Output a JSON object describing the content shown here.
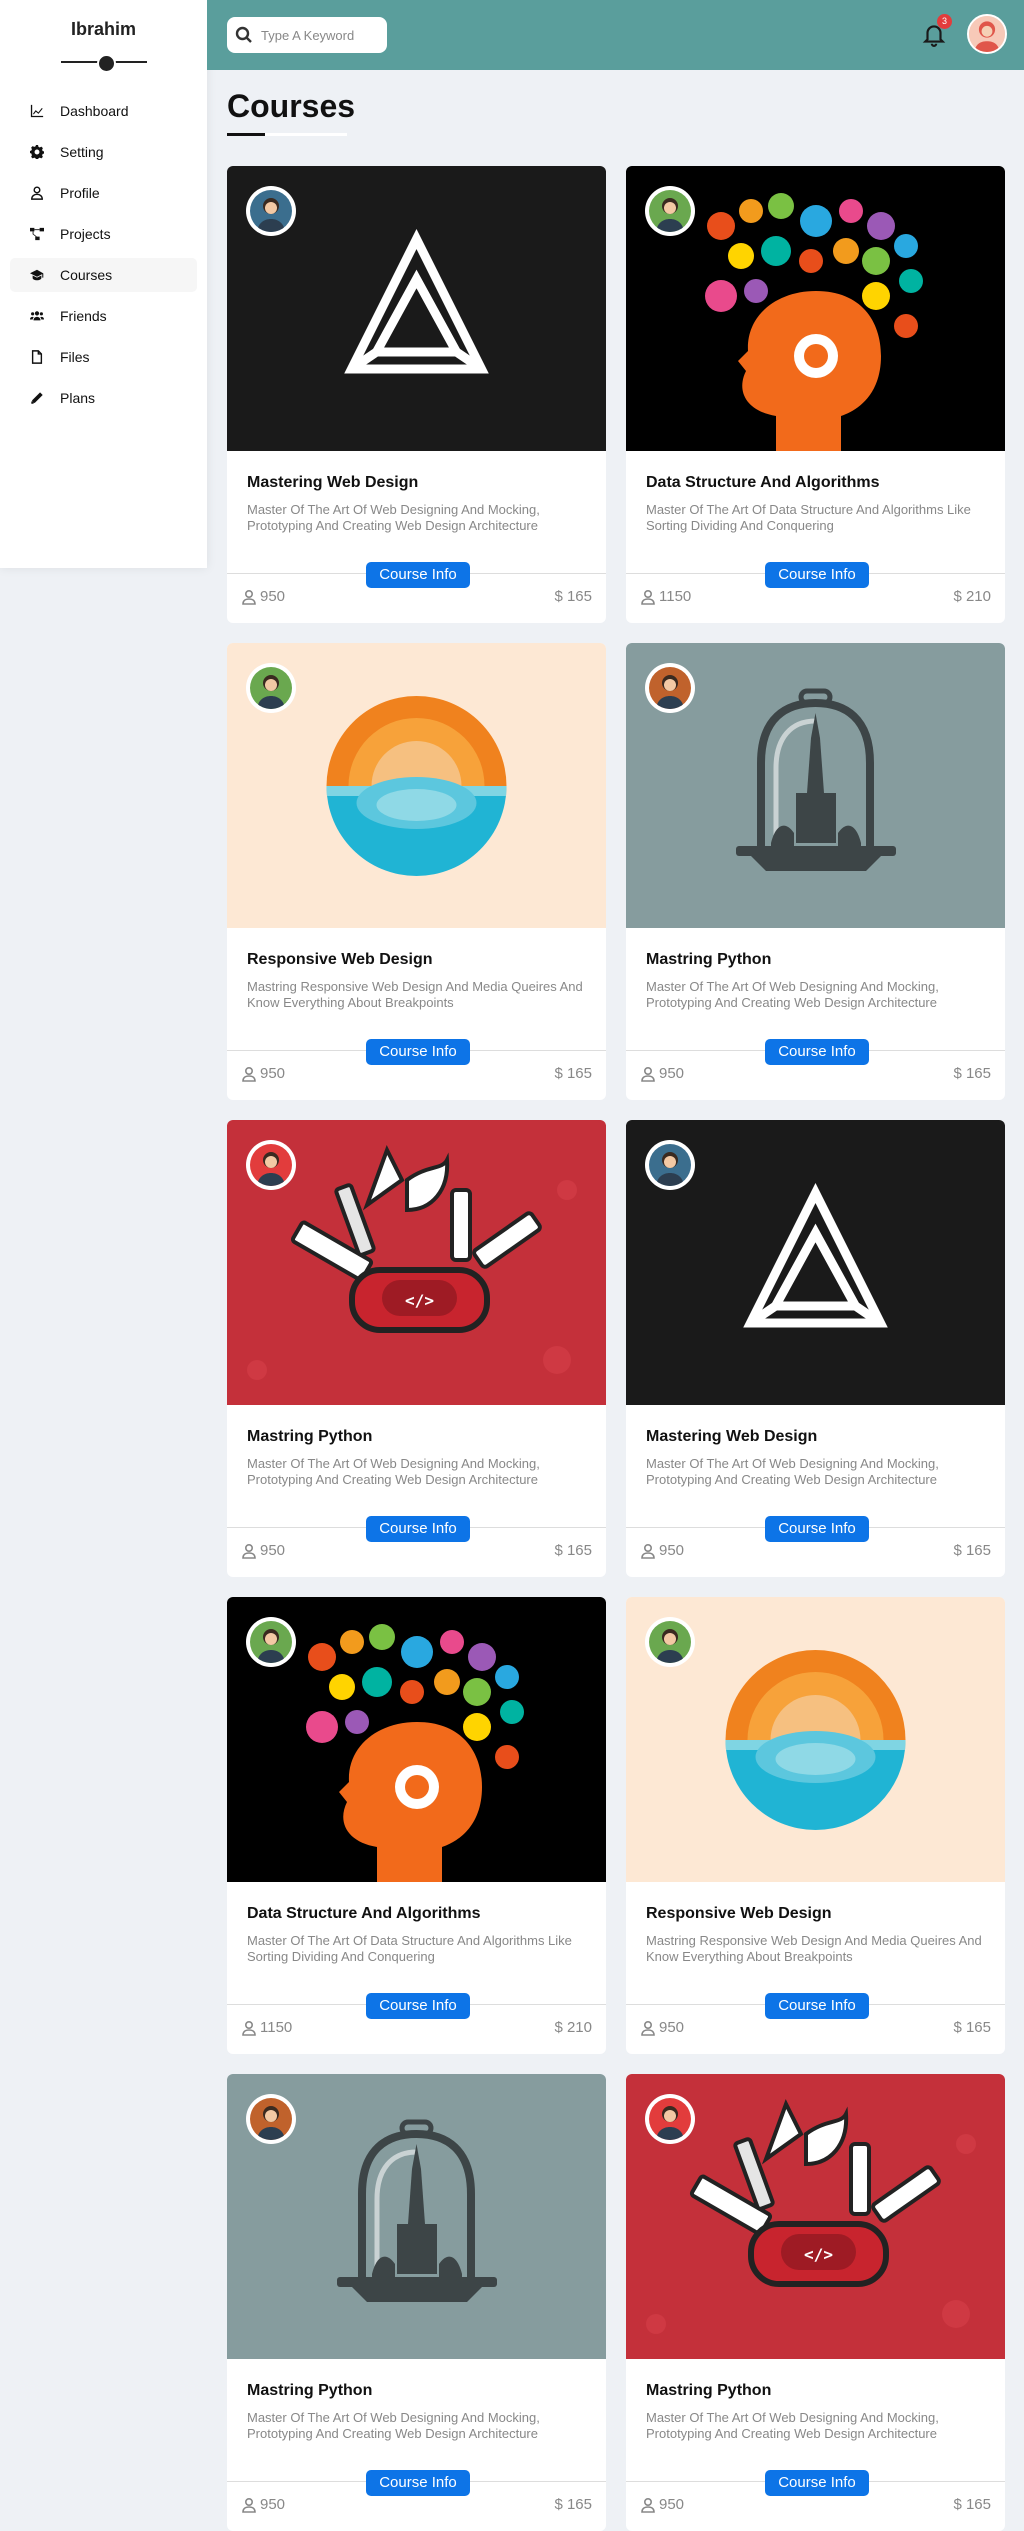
{
  "sidebar": {
    "brand": "Ibrahim",
    "items": [
      {
        "label": "Dashboard",
        "icon": "chart-line-icon"
      },
      {
        "label": "Setting",
        "icon": "gear-icon"
      },
      {
        "label": "Profile",
        "icon": "user-icon"
      },
      {
        "label": "Projects",
        "icon": "diagram-icon"
      },
      {
        "label": "Courses",
        "icon": "graduation-cap-icon"
      },
      {
        "label": "Friends",
        "icon": "users-icon"
      },
      {
        "label": "Files",
        "icon": "file-icon"
      },
      {
        "label": "Plans",
        "icon": "pen-icon"
      }
    ],
    "active_index": 4
  },
  "header": {
    "search_placeholder": "Type A Keyword",
    "notification_count": "3"
  },
  "page": {
    "title": "Courses"
  },
  "colors": {
    "header_bg": "#5a9e9c",
    "button": "#0d74e7",
    "badge": "#e33c3c"
  },
  "courses": [
    {
      "title": "Mastering Web Design",
      "desc": "Master Of The Art Of Web Designing And Mocking, Prototyping And Creating Web Design Architecture",
      "students": "950",
      "price": "$ 165",
      "button": "Course Info",
      "art": "triangle-logo",
      "bg": "#1a1a1a"
    },
    {
      "title": "Data Structure And Algorithms",
      "desc": "Master Of The Art Of Data Structure And Algorithms Like Sorting Dividing And Conquering",
      "students": "1150",
      "price": "$ 210",
      "button": "Course Info",
      "art": "head-ideas",
      "bg": "#000000"
    },
    {
      "title": "Responsive Web Design",
      "desc": "Mastring Responsive Web Design And Media Queires And Know Everything About Breakpoints",
      "students": "950",
      "price": "$ 165",
      "button": "Course Info",
      "art": "sunset-circle",
      "bg": "#fde8d4"
    },
    {
      "title": "Mastring Python",
      "desc": "Master Of The Art Of Web Designing And Mocking, Prototyping And Creating Web Design Architecture",
      "students": "950",
      "price": "$ 165",
      "button": "Course Info",
      "art": "bell-jar",
      "bg": "#869c9e"
    },
    {
      "title": "Mastring Python",
      "desc": "Master Of The Art Of Web Designing And Mocking, Prototyping And Creating Web Design Architecture",
      "students": "950",
      "price": "$ 165",
      "button": "Course Info",
      "art": "swiss-knife",
      "bg": "#c4303a"
    },
    {
      "title": "Mastering Web Design",
      "desc": "Master Of The Art Of Web Designing And Mocking, Prototyping And Creating Web Design Architecture",
      "students": "950",
      "price": "$ 165",
      "button": "Course Info",
      "art": "triangle-logo",
      "bg": "#1a1a1a"
    },
    {
      "title": "Data Structure And Algorithms",
      "desc": "Master Of The Art Of Data Structure And Algorithms Like Sorting Dividing And Conquering",
      "students": "1150",
      "price": "$ 210",
      "button": "Course Info",
      "art": "head-ideas",
      "bg": "#000000"
    },
    {
      "title": "Responsive Web Design",
      "desc": "Mastring Responsive Web Design And Media Queires And Know Everything About Breakpoints",
      "students": "950",
      "price": "$ 165",
      "button": "Course Info",
      "art": "sunset-circle",
      "bg": "#fde8d4"
    },
    {
      "title": "Mastring Python",
      "desc": "Master Of The Art Of Web Designing And Mocking, Prototyping And Creating Web Design Architecture",
      "students": "950",
      "price": "$ 165",
      "button": "Course Info",
      "art": "bell-jar",
      "bg": "#869c9e"
    },
    {
      "title": "Mastring Python",
      "desc": "Master Of The Art Of Web Designing And Mocking, Prototyping And Creating Web Design Architecture",
      "students": "950",
      "price": "$ 165",
      "button": "Course Info",
      "art": "swiss-knife",
      "bg": "#c4303a"
    }
  ]
}
